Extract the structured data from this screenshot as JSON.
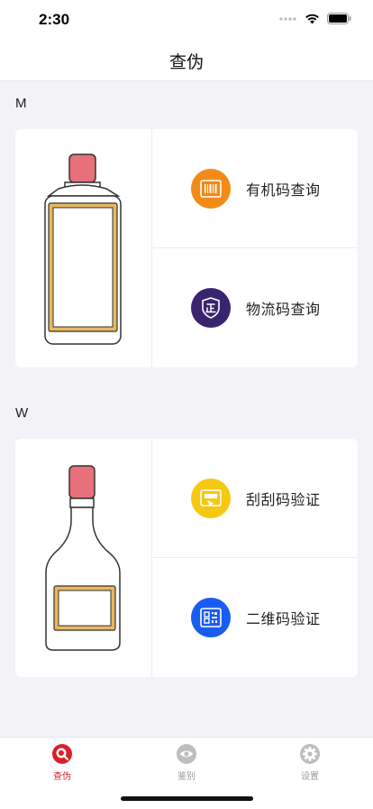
{
  "status": {
    "time": "2:30"
  },
  "nav": {
    "title": "查伪"
  },
  "sections": [
    {
      "label": "M",
      "options": [
        {
          "label": "有机码查询",
          "icon": "barcode-icon",
          "color": "#f28a18"
        },
        {
          "label": "物流码查询",
          "icon": "shield-zheng-icon",
          "color": "#3a2470"
        }
      ]
    },
    {
      "label": "W",
      "options": [
        {
          "label": "刮刮码验证",
          "icon": "scratch-card-icon",
          "color": "#f6c814"
        },
        {
          "label": "二维码验证",
          "icon": "qr-code-icon",
          "color": "#1a5cf0"
        }
      ]
    }
  ],
  "tabs": [
    {
      "label": "查伪",
      "icon": "search-icon",
      "active": true,
      "color": "#d8202a"
    },
    {
      "label": "鉴别",
      "icon": "eye-icon",
      "active": false,
      "color": "#999999"
    },
    {
      "label": "设置",
      "icon": "gear-icon",
      "active": false,
      "color": "#999999"
    }
  ],
  "colors": {
    "accent": "#d8202a",
    "bottle_cap": "#e8707a",
    "bottle_label": "#e8b860"
  }
}
